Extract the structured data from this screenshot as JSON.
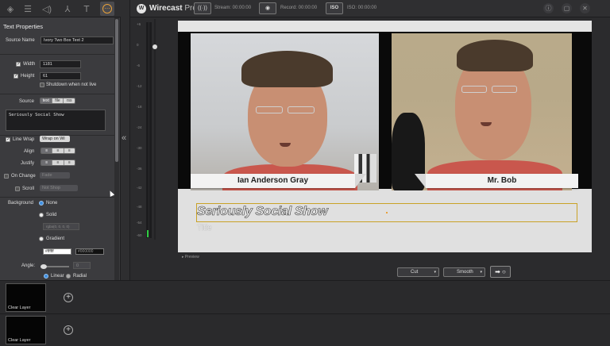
{
  "app": {
    "logo_letter": "W",
    "name": "Wirecast",
    "edition": "Pro"
  },
  "topbar": {
    "stream_label": "Stream: 00:00:00",
    "record_label": "Record: 00:00:00",
    "iso_label": "ISO: 00:00:00",
    "iso_button": "ISO"
  },
  "tabs": [
    "layers-icon",
    "sliders-icon",
    "audio-icon",
    "transform-icon",
    "text-icon",
    "title-icon"
  ],
  "panel": {
    "title": "Text Properties",
    "source_name_label": "Source Name",
    "source_name_value": "Ivory Two Box Text 2",
    "width_label": "Width",
    "width_value": "1181",
    "height_label": "Height",
    "height_value": "61",
    "shutdown_label": "Shutdown when not live",
    "source_label": "Source",
    "source_options": [
      "text",
      "file",
      "rss"
    ],
    "text_content": "Seriously Social Show",
    "linewrap_label": "Line Wrap",
    "linewrap_value": "Wrap on Wi",
    "align_label": "Align",
    "justify_label": "Justify",
    "onchange_label": "On Change",
    "onchange_value": "Fade",
    "scroll_label": "Scroll",
    "scroll_value": "Not Shop",
    "background_label": "Background",
    "bg_none": "None",
    "bg_solid": "Solid",
    "solid_value": "rgba(0, 0, 0, 0)",
    "bg_gradient": "Gradient",
    "gradient_from": "#ffffff",
    "gradient_to": "#000000",
    "angle_label": "Angle:",
    "angle_value": "0",
    "linear_label": "Linear",
    "radial_label": "Radial"
  },
  "meter_ticks": [
    "+6",
    "0",
    "-6",
    "-12",
    "-18",
    "-24",
    "-30",
    "-36",
    "-42",
    "-48",
    "-54",
    "-60"
  ],
  "preview": {
    "label": "Preview",
    "name1": "Ian Anderson Gray",
    "name2": "Mr. Bob",
    "title": "Seriously Social Show",
    "subtitle": "Title"
  },
  "transitions": {
    "cut": "Cut",
    "smooth": "Smooth",
    "go_symbol": "➡ ○"
  },
  "layers": [
    {
      "label": "Clear Layer"
    },
    {
      "label": "Clear Layer"
    }
  ],
  "colors": {
    "accent": "#e8a13a",
    "title_border": "#c9a227",
    "meter_green": "#2ecc40"
  }
}
